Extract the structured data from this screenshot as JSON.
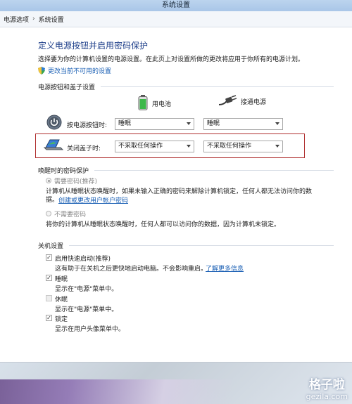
{
  "window": {
    "title": "系统设置"
  },
  "breadcrumb": {
    "items": [
      "电源选项",
      "系统设置"
    ],
    "separator": "›"
  },
  "page": {
    "title": "定义电源按钮并启用密码保护",
    "description": "选择要为你的计算机设置的电源设置。在此页上对设置所做的更改将应用于你所有的电源计划。",
    "change_link": "更改当前不可用的设置"
  },
  "power_section": {
    "title": "电源按钮和盖子设置",
    "battery_label": "用电池",
    "plugged_label": "接通电源",
    "power_button": {
      "label": "按电源按钮时:",
      "battery_value": "睡眠",
      "plugged_value": "睡眠"
    },
    "lid": {
      "label": "关闭盖子时:",
      "battery_value": "不采取任何操作",
      "plugged_value": "不采取任何操作"
    }
  },
  "password_section": {
    "title": "唤醒时的密码保护",
    "require_label": "需要密码(推荐)",
    "require_desc": "计算机从睡眠状态唤醒时，如果未输入正确的密码来解除计算机锁定，任何人都无法访问你的数",
    "require_desc2": "据。",
    "account_link": "创建或更改用户帐户密码",
    "no_label": "不需要密码",
    "no_desc": "将你的计算机从睡眠状态唤醒时，任何人都可以访问你的数据，因为计算机未锁定。"
  },
  "shutdown_section": {
    "title": "关机设置",
    "fast_startup": {
      "label": "启用快速启动(推荐)",
      "desc": "这有助于在关机之后更快地启动电脑。不会影响重启。",
      "link": "了解更多信息",
      "checked": true
    },
    "sleep": {
      "label": "睡眠",
      "desc": "显示在\"电源\"菜单中。",
      "checked": true
    },
    "hibernate": {
      "label": "休眠",
      "desc": "显示在\"电源\"菜单中。",
      "checked": false
    },
    "lock": {
      "label": "锁定",
      "desc": "显示在用户头像菜单中。",
      "checked": true
    }
  },
  "watermark": {
    "line1": "格子啦",
    "line2": "gezila.com"
  },
  "colors": {
    "accent": "#1e3f8a",
    "link": "#1a5fb4",
    "highlight_border": "#b03030"
  }
}
